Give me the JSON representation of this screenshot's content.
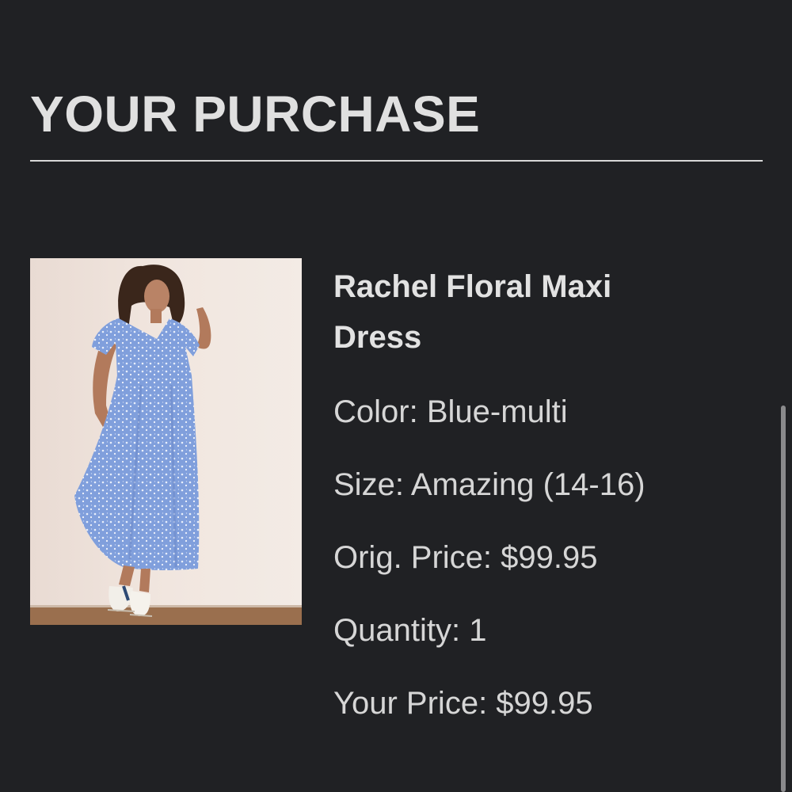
{
  "purchase": {
    "title": "YOUR PURCHASE",
    "product": {
      "name": "Rachel Floral Maxi Dress",
      "image_alt": "Model wearing blue floral maxi dress",
      "color_line": "Color: Blue-multi",
      "size_line": "Size: Amazing (14-16)",
      "orig_price_line": "Orig. Price: $99.95",
      "quantity_line": "Quantity: 1",
      "your_price_line": "Your Price: $99.95"
    }
  },
  "colors": {
    "background": "#202124",
    "text": "#dcdcdc",
    "dress": "#7f9fdb",
    "photo_wall": "#ede1da"
  }
}
